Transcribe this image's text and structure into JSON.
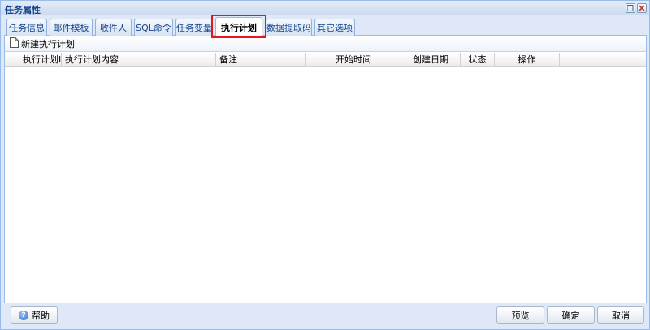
{
  "window": {
    "title": "任务属性"
  },
  "tabs": [
    {
      "label": "任务信息"
    },
    {
      "label": "邮件模板"
    },
    {
      "label": "收件人"
    },
    {
      "label": "SQL命令"
    },
    {
      "label": "任务变量"
    },
    {
      "label": "执行计划",
      "active": true
    },
    {
      "label": "数据提取码"
    },
    {
      "label": "其它选项"
    }
  ],
  "toolbar": {
    "new_plan_label": "新建执行计划"
  },
  "grid": {
    "columns": [
      {
        "label": "执行计划ID"
      },
      {
        "label": "执行计划内容"
      },
      {
        "label": "备注"
      },
      {
        "label": "开始时间"
      },
      {
        "label": "创建日期"
      },
      {
        "label": "状态"
      },
      {
        "label": "操作"
      }
    ],
    "rows": []
  },
  "footer": {
    "help_label": "帮助",
    "preview_label": "预览",
    "ok_label": "确定",
    "cancel_label": "取消"
  },
  "colors": {
    "accent_border": "#99bbe8",
    "highlight": "#e8141e",
    "title_text": "#15428b"
  }
}
